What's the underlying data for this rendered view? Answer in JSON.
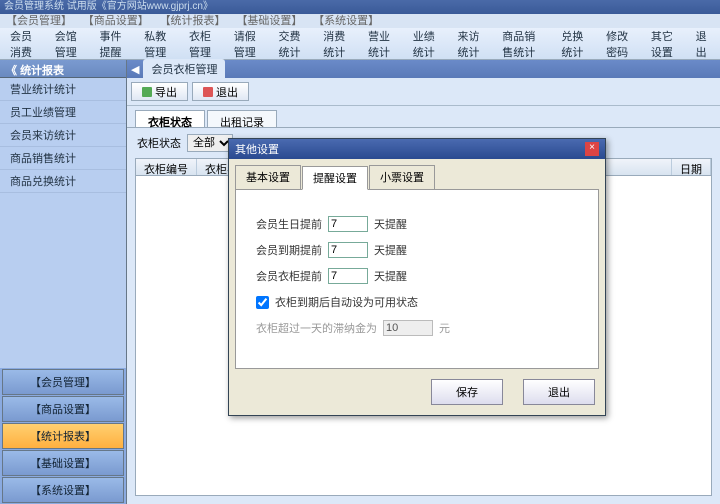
{
  "title": "会员管理系统 试用版《官方网站www.gjprj.cn》",
  "menus": [
    "【会员管理】",
    "【商品设置】",
    "【统计报表】",
    "【基础设置】",
    "【系统设置】"
  ],
  "toolbar": [
    "会员消费",
    "会馆管理",
    "事件提醒",
    "私教管理",
    "衣柜管理",
    "请假管理",
    "交费统计",
    "消费统计",
    "营业统计",
    "业绩统计",
    "来访统计",
    "商品销售统计",
    "兑换统计",
    "修改密码",
    "其它设置",
    "退出"
  ],
  "sidebar": {
    "head": "统计报表",
    "items": [
      "营业统计统计",
      "员工业绩管理",
      "会员来访统计",
      "商品销售统计",
      "商品兑换统计"
    ],
    "bottom": [
      "【会员管理】",
      "【商品设置】",
      "【统计报表】",
      "【基础设置】",
      "【系统设置】"
    ],
    "active": 2
  },
  "content": {
    "tab": "会员衣柜管理",
    "btns": {
      "export": "导出",
      "exit": "退出"
    },
    "subtabs": [
      "衣柜状态",
      "出租记录"
    ],
    "filter": {
      "label": "衣柜状态",
      "all": "全部"
    },
    "cols": [
      "衣柜编号",
      "衣柜名称",
      "",
      "",
      "",
      "日期"
    ]
  },
  "dialog": {
    "title": "其他设置",
    "tabs": [
      "基本设置",
      "提醒设置",
      "小票设置"
    ],
    "r1a": "会员生日提前",
    "r1v": "7",
    "r1b": "天提醒",
    "r2a": "会员到期提前",
    "r2v": "7",
    "r2b": "天提醒",
    "r3a": "会员衣柜提前",
    "r3v": "7",
    "r3b": "天提醒",
    "chk": "衣柜到期后自动设为可用状态",
    "r5a": "衣柜超过一天的滞纳金为",
    "r5v": "10",
    "r5b": "元",
    "save": "保存",
    "exit": "退出"
  }
}
